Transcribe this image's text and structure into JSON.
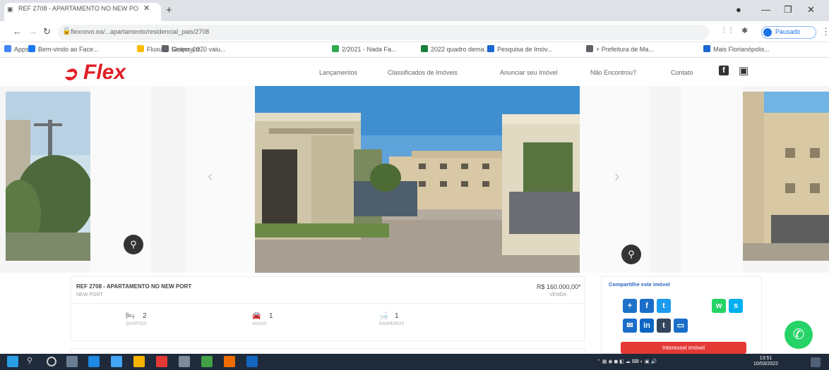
{
  "browser": {
    "tab_title": "REF 2708 - APARTAMENTO NO NEW PORT",
    "url": "flexnovo.ea/...apartamento/residencial_pais/2708",
    "profile_label": "Pausado",
    "bookmarks": [
      {
        "label": "Apps",
        "color": "#4285f4"
      },
      {
        "label": "Bem-vindo ao Face...",
        "color": "#1877f2"
      },
      {
        "label": "Fluxus - Sistema d...",
        "color": "#fbbc04"
      },
      {
        "label": "Grupo_2070 vaiu...",
        "color": "#5f6368"
      },
      {
        "label": "2/2021 - Nada Fa...",
        "color": "#34a853"
      },
      {
        "label": "2022 quadro dema...",
        "color": "#188038"
      },
      {
        "label": "Pesquisa de Imóv...",
        "color": "#1967d2"
      },
      {
        "label": "+ Prefeitura de Ma...",
        "color": "#5f6368"
      },
      {
        "label": "Mais Florianópolis...",
        "color": "#1967d2"
      }
    ]
  },
  "site": {
    "logo_text": "Flex",
    "nav": [
      "Lançamentos",
      "Classificados de Imóveis",
      "Anunciar seu Imóvel",
      "Não Encontrou?",
      "Contato"
    ]
  },
  "listing": {
    "ref_title": "REF 2708 - APARTAMENTO NO NEW PORT",
    "location": "NEW PORT",
    "price": "R$ 160.000,00*",
    "price_type": "VENDA",
    "features": [
      {
        "icon": "bed-icon",
        "value": "2",
        "label": "QUARTOS"
      },
      {
        "icon": "car-icon",
        "value": "1",
        "label": "VAGAS"
      },
      {
        "icon": "bath-icon",
        "value": "1",
        "label": "BANHEIROS"
      }
    ]
  },
  "share": {
    "title": "Compartilhe este imóvel",
    "interest_label": "Interessei imóvel"
  },
  "taskbar": {
    "time": "13:51",
    "date": "10/03/2022"
  }
}
